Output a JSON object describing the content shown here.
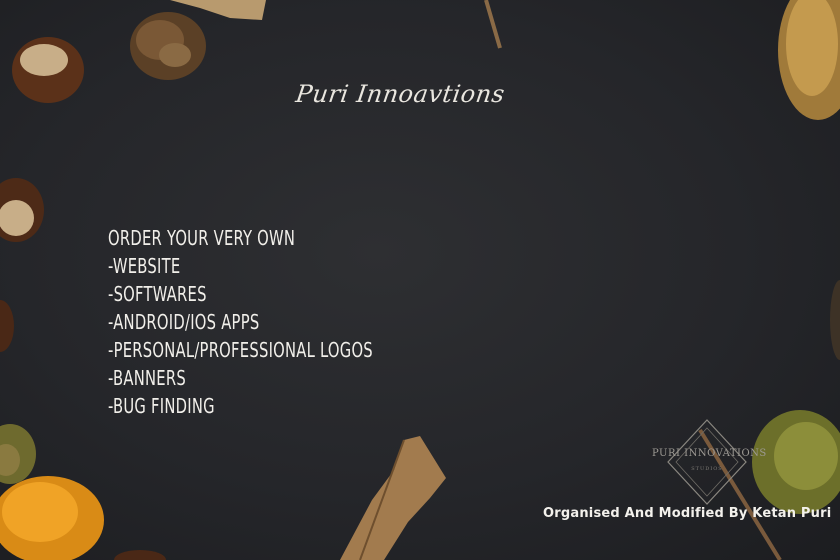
{
  "brand": {
    "title": "Puri Innoavtions"
  },
  "services": {
    "heading": "Order Your Very Own",
    "items": [
      "-Website",
      "-Softwares",
      "-Android/iOS Apps",
      "-Personal/Professional Logos",
      "-Banners",
      "-Bug Finding"
    ]
  },
  "watermark": {
    "name": "PURI INNOVATIONS",
    "tagline": "STUDIOS"
  },
  "credit": "Organised And Modified By Ketan Puri",
  "colors": {
    "background": "#25262a",
    "text": "#f1efea"
  }
}
